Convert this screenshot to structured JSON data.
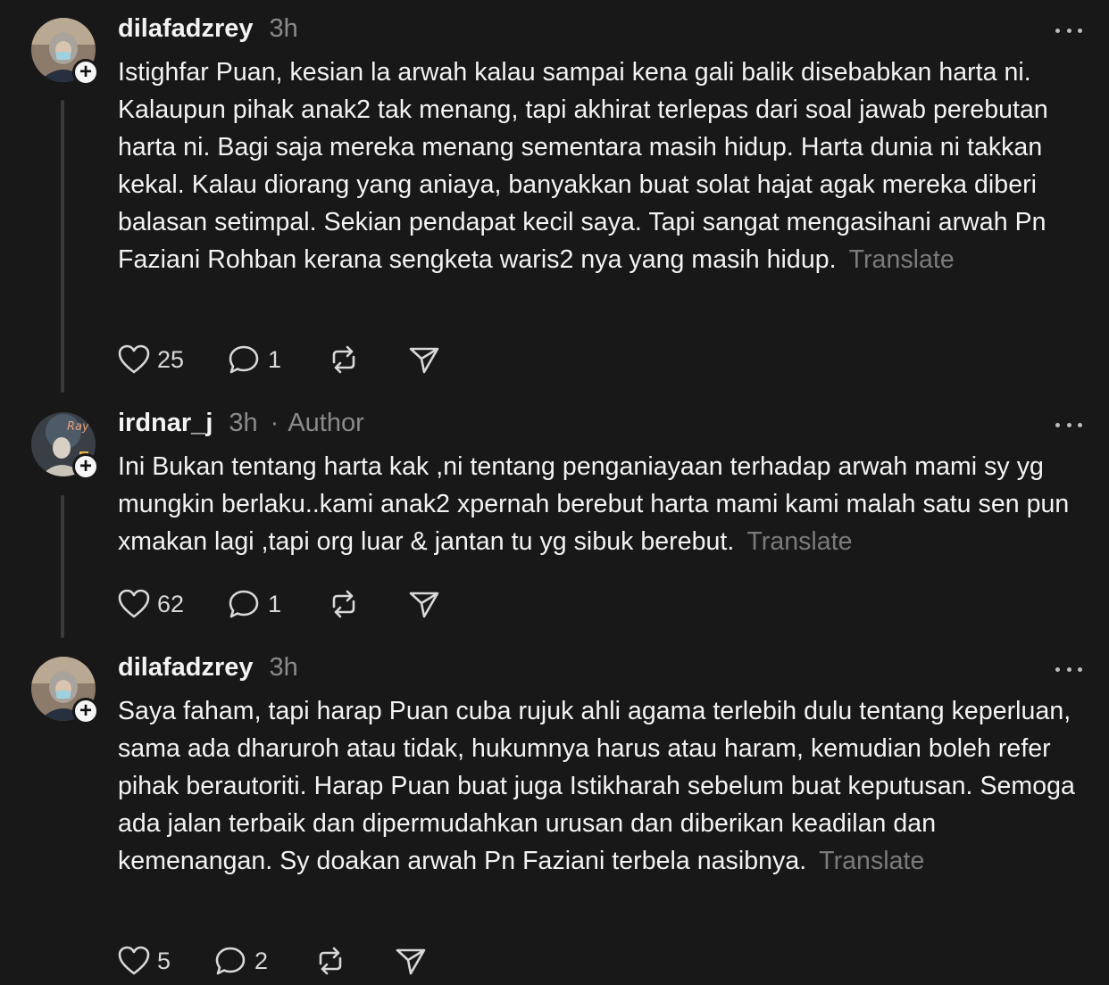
{
  "comments": [
    {
      "username": "dilafadzrey",
      "time": "3h",
      "author_label": "",
      "body": "Istighfar Puan, kesian la arwah kalau sampai kena gali balik disebabkan harta ni. Kalaupun pihak anak2 tak menang, tapi akhirat terlepas dari soal jawab perebutan harta ni. Bagi saja mereka menang sementara masih hidup. Harta dunia ni takkan kekal. Kalau diorang yang aniaya, banyakkan buat solat hajat agak mereka diberi balasan setimpal. Sekian pendapat kecil saya. Tapi sangat mengasihani arwah Pn Faziani Rohban kerana sengketa waris2 nya yang masih hidup.",
      "translate": "Translate",
      "likes": "25",
      "replies": "1"
    },
    {
      "username": "irdnar_j",
      "time": "3h",
      "dot": "·",
      "author_label": "Author",
      "body": "Ini Bukan tentang harta kak ,ni tentang penganiayaan terhadap arwah mami sy yg mungkin berlaku..kami anak2 xpernah berebut harta mami kami malah satu sen pun xmakan lagi ,tapi org luar & jantan tu yg sibuk berebut.",
      "translate": "Translate",
      "likes": "62",
      "replies": "1"
    },
    {
      "username": "dilafadzrey",
      "time": "3h",
      "author_label": "",
      "body": "Saya faham, tapi harap Puan cuba rujuk ahli agama terlebih dulu tentang keperluan, sama ada dharuroh atau tidak, hukumnya harus atau haram, kemudian boleh refer pihak berautoriti. Harap Puan buat juga Istikharah sebelum buat keputusan. Semoga ada jalan terbaik dan dipermudahkan urusan dan diberikan keadilan dan kemenangan. Sy doakan arwah Pn Faziani terbela nasibnya.",
      "translate": "Translate",
      "likes": "5",
      "replies": "2"
    }
  ],
  "icons": {
    "like": "heart-icon",
    "reply": "comment-bubble-icon",
    "repost": "repost-icon",
    "share": "send-paper-plane-icon",
    "more": "more-dots-icon",
    "follow": "plus-icon"
  },
  "colors": {
    "background": "#181818",
    "text": "#f3f3f3",
    "muted": "#8a8a8a",
    "thread_line": "#3a3a3a"
  }
}
